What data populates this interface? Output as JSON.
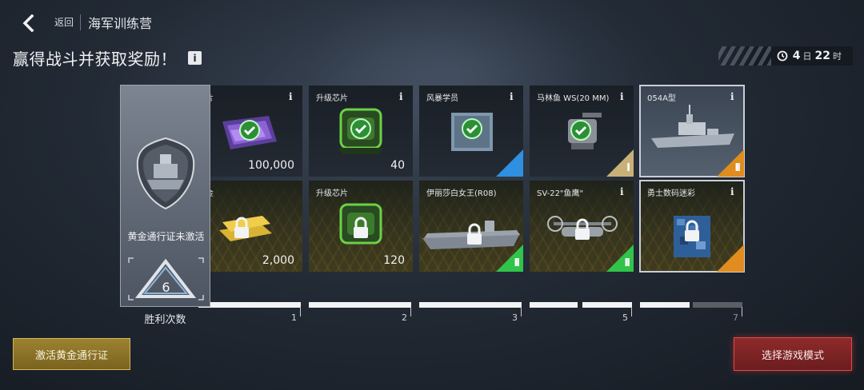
{
  "header": {
    "back_label": "返回",
    "title": "海军训练营",
    "subtitle": "赢得战斗并获取奖励！",
    "info_glyph": "i"
  },
  "timer": {
    "icon": "clock-icon",
    "days": "4",
    "days_unit": "日",
    "hours": "22",
    "hours_unit": "时"
  },
  "pass": {
    "status": "黄金通行证未激活",
    "wins": "6",
    "wins_label": "胜利次数"
  },
  "rewards": {
    "free": [
      {
        "title": "片",
        "qty": "100,000",
        "claimed": true,
        "icon": "chip-purple-icon"
      },
      {
        "title": "升级芯片",
        "qty": "40",
        "claimed": true,
        "icon": "chip-green-icon"
      },
      {
        "title": "风暴学员",
        "qty": "",
        "claimed": true,
        "icon": "crew-portrait-icon",
        "rarity": "blue"
      },
      {
        "title": "马林鱼 WS(20 MM)",
        "qty": "",
        "claimed": true,
        "icon": "turret-icon",
        "rarity": "tan",
        "level": "I"
      },
      {
        "title": "054A型",
        "qty": "",
        "claimed": false,
        "icon": "frigate-icon",
        "rarity": "orange",
        "level": "II"
      }
    ],
    "gold": [
      {
        "title": "金",
        "qty": "2,000",
        "locked": true,
        "icon": "gold-bars-icon"
      },
      {
        "title": "升级芯片",
        "qty": "120",
        "locked": true,
        "icon": "chip-green-icon"
      },
      {
        "title": "伊丽莎白女王(R08)",
        "qty": "",
        "locked": true,
        "icon": "carrier-icon",
        "rarity": "green",
        "level": "II"
      },
      {
        "title": "SV-22\"鱼鹰\"",
        "qty": "",
        "locked": true,
        "icon": "tiltrotor-icon",
        "rarity": "green",
        "level": "II"
      },
      {
        "title": "勇士数码迷彩",
        "qty": "",
        "locked": true,
        "icon": "camo-icon",
        "rarity": "orange"
      }
    ],
    "tiers": [
      "1",
      "2",
      "3",
      "5",
      "7"
    ]
  },
  "buttons": {
    "activate": "激活黄金通行证",
    "select_mode": "选择游戏模式"
  },
  "colors": {
    "gold_accent": "#d6b756",
    "red_accent": "#e14a4a",
    "check_green": "#3fd14a",
    "rarity_blue": "#2f8fe0",
    "rarity_green": "#31c44a",
    "rarity_orange": "#e08c1e",
    "rarity_tan": "#c8b178"
  }
}
